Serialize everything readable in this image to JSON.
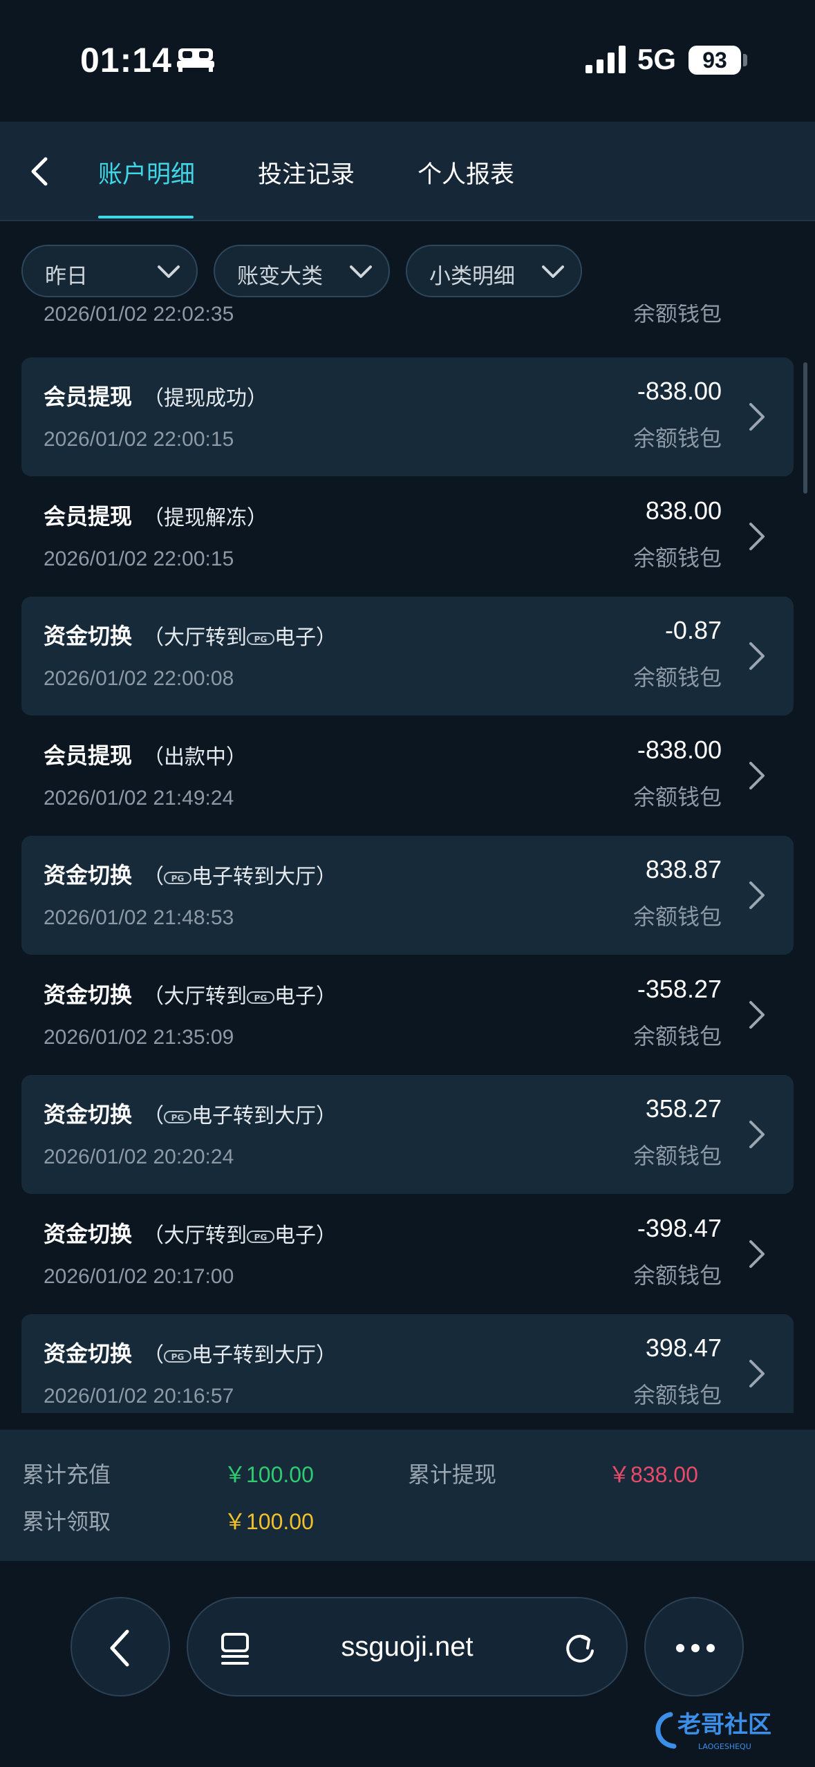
{
  "status": {
    "time": "01:14",
    "network": "5G",
    "battery": "93"
  },
  "tabs": [
    {
      "label": "账户明细",
      "active": true
    },
    {
      "label": "投注记录",
      "active": false
    },
    {
      "label": "个人报表",
      "active": false
    }
  ],
  "filters": [
    {
      "label": "昨日"
    },
    {
      "label": "账变大类"
    },
    {
      "label": "小类明细"
    }
  ],
  "partial_row": {
    "time": "2026/01/02 22:02:35",
    "wallet": "余额钱包"
  },
  "rows": [
    {
      "title": "会员提现",
      "sub": "（提现成功）",
      "time": "2026/01/02 22:00:15",
      "amount": "-838.00",
      "wallet": "余额钱包"
    },
    {
      "title": "会员提现",
      "sub": "（提现解冻）",
      "time": "2026/01/02 22:00:15",
      "amount": "838.00",
      "wallet": "余额钱包"
    },
    {
      "title": "资金切换",
      "sub_a": "（大厅转到",
      "badge": "PG",
      "sub_b": "电子）",
      "time": "2026/01/02 22:00:08",
      "amount": "-0.87",
      "wallet": "余额钱包"
    },
    {
      "title": "会员提现",
      "sub": "（出款中）",
      "time": "2026/01/02 21:49:24",
      "amount": "-838.00",
      "wallet": "余额钱包"
    },
    {
      "title": "资金切换",
      "sub_a": "（",
      "badge": "PG",
      "sub_b": "电子转到大厅）",
      "time": "2026/01/02 21:48:53",
      "amount": "838.87",
      "wallet": "余额钱包"
    },
    {
      "title": "资金切换",
      "sub_a": "（大厅转到",
      "badge": "PG",
      "sub_b": "电子）",
      "time": "2026/01/02 21:35:09",
      "amount": "-358.27",
      "wallet": "余额钱包"
    },
    {
      "title": "资金切换",
      "sub_a": "（",
      "badge": "PG",
      "sub_b": "电子转到大厅）",
      "time": "2026/01/02 20:20:24",
      "amount": "358.27",
      "wallet": "余额钱包"
    },
    {
      "title": "资金切换",
      "sub_a": "（大厅转到",
      "badge": "PG",
      "sub_b": "电子）",
      "time": "2026/01/02 20:17:00",
      "amount": "-398.47",
      "wallet": "余额钱包"
    },
    {
      "title": "资金切换",
      "sub_a": "（",
      "badge": "PG",
      "sub_b": "电子转到大厅）",
      "time": "2026/01/02 20:16:57",
      "amount": "398.47",
      "wallet": "余额钱包"
    }
  ],
  "totals": {
    "recharge_label": "累计充值",
    "recharge_value": "￥100.00",
    "withdraw_label": "累计提现",
    "withdraw_value": "￥838.00",
    "claim_label": "累计领取",
    "claim_value": "￥100.00"
  },
  "browser": {
    "url": "ssguoji.net"
  },
  "watermark": {
    "text": "老哥社区",
    "sub": "LAOGESHEQU"
  },
  "colors": {
    "accent": "#3fd6e6",
    "green": "#2ecc71",
    "red": "#e84b6a",
    "yellow": "#f2c02a"
  }
}
